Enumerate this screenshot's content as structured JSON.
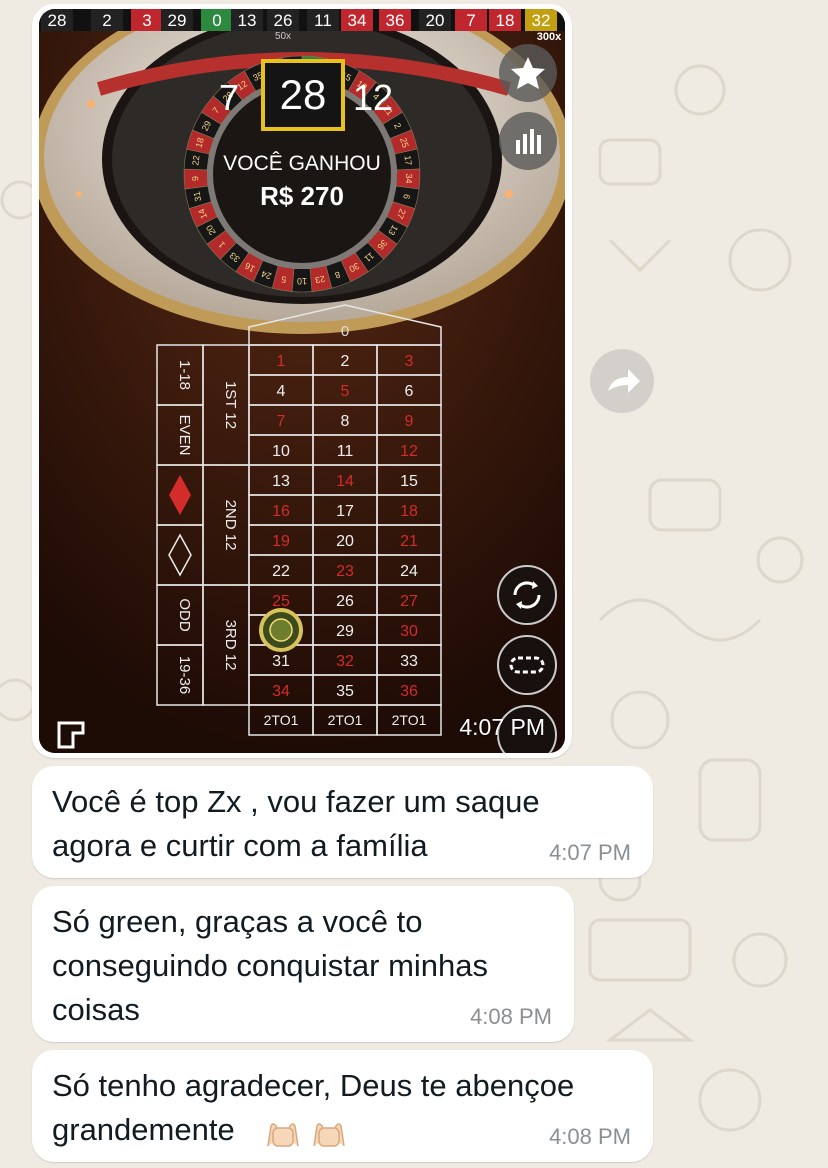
{
  "history": {
    "numbers": [
      "28",
      "2",
      "3",
      "29",
      "0",
      "13",
      "26",
      "11",
      "34",
      "36",
      "20",
      "7",
      "18",
      "32"
    ],
    "colors": [
      "#222222",
      "#222222",
      "#c0262d",
      "#222222",
      "#2c8a3e",
      "#222222",
      "#222222",
      "#222222",
      "#c0262d",
      "#c0262d",
      "#222222",
      "#c0262d",
      "#c0262d",
      "#c2a012"
    ],
    "multiplier_26": "50x",
    "multiplier_32": "300x"
  },
  "wheel": {
    "result": "28",
    "left_neighbor": "7",
    "right_neighbor": "12",
    "win_label": "VOCÊ GANHOU",
    "win_amount": "R$ 270"
  },
  "table": {
    "zero": "0",
    "rows": [
      [
        "1",
        "2",
        "3"
      ],
      [
        "4",
        "5",
        "6"
      ],
      [
        "7",
        "8",
        "9"
      ],
      [
        "10",
        "11",
        "12"
      ],
      [
        "13",
        "14",
        "15"
      ],
      [
        "16",
        "17",
        "18"
      ],
      [
        "19",
        "20",
        "21"
      ],
      [
        "22",
        "23",
        "24"
      ],
      [
        "25",
        "26",
        "27"
      ],
      [
        "28",
        "29",
        "30"
      ],
      [
        "31",
        "32",
        "33"
      ],
      [
        "34",
        "35",
        "36"
      ]
    ],
    "reds": [
      "1",
      "3",
      "5",
      "7",
      "9",
      "12",
      "14",
      "16",
      "18",
      "19",
      "21",
      "23",
      "25",
      "27",
      "30",
      "32",
      "34",
      "36"
    ],
    "columns": [
      "2TO1",
      "2TO1",
      "2TO1"
    ],
    "dozens": [
      "1ST 12",
      "2ND 12",
      "3RD 12"
    ],
    "outside": [
      "1-18",
      "EVEN",
      "ODD",
      "19-36"
    ]
  },
  "image_timestamp": "4:07 PM",
  "messages": [
    {
      "text": "Você é top Zx , vou fazer um saque\nagora e curtir com a família",
      "time": "4:07 PM"
    },
    {
      "text": "Só green, graças a você to\nconseguindo conquistar minhas\ncoisas",
      "time": "4:08 PM"
    },
    {
      "text": "Só tenho agradecer, Deus te abençoe\ngrandemente",
      "time": "4:08 PM",
      "emoji": "raising-hands-emoji"
    }
  ],
  "colors": {
    "red": "#c0262d",
    "black": "#1a1a1a",
    "gold": "#e8c21b",
    "bubble": "#ffffff",
    "wallpaper": "#efeae2"
  }
}
